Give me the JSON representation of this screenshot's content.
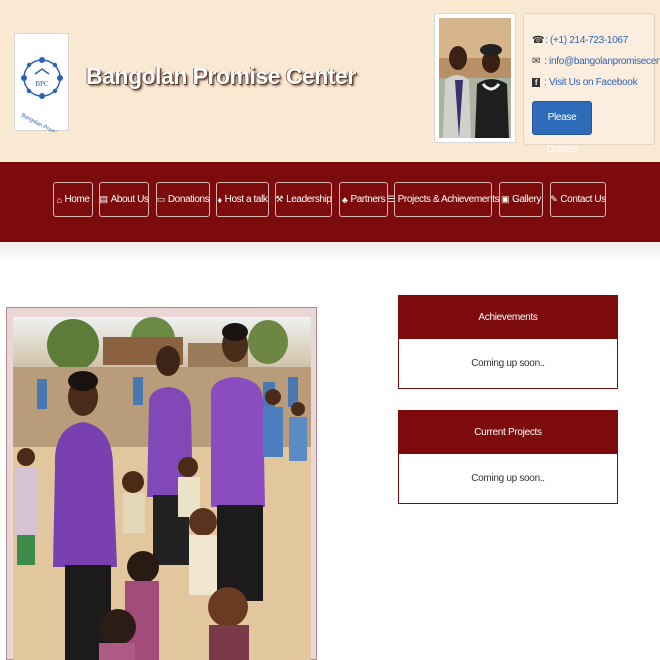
{
  "header": {
    "title": "Bangolan Promise Center",
    "logo": {
      "initials": "BPC",
      "ring_text": "Bangolan Promise Center"
    },
    "contact": {
      "phone": ": (+1) 214-723-1067",
      "email": ": info@bangolanpromisecenter.net",
      "facebook": ": Visit Us on Facebook",
      "donate_label": "Please Donate"
    }
  },
  "nav": {
    "items": [
      {
        "label": "Home",
        "icon": "home-icon"
      },
      {
        "label": "About Us",
        "icon": "book-icon"
      },
      {
        "label": "Donations",
        "icon": "inbox-icon"
      },
      {
        "label": "Host a talk",
        "icon": "microphone-icon"
      },
      {
        "label": "Leadership",
        "icon": "wrench-icon"
      },
      {
        "label": "Partners",
        "icon": "users-icon"
      },
      {
        "label": "Projects & Achievements",
        "icon": "tasks-icon"
      },
      {
        "label": "Gallery",
        "icon": "photo-icon"
      },
      {
        "label": "Contact Us",
        "icon": "edit-icon"
      }
    ]
  },
  "panels": [
    {
      "title": "Achievements",
      "body": "Coming up soon.."
    },
    {
      "title": "Current Projects",
      "body": "Coming up soon.."
    }
  ],
  "colors": {
    "brand": "#7d0b0b",
    "header_bg": "#f9e9d3",
    "link": "#2d64b8",
    "donate": "#2e6bb8"
  }
}
